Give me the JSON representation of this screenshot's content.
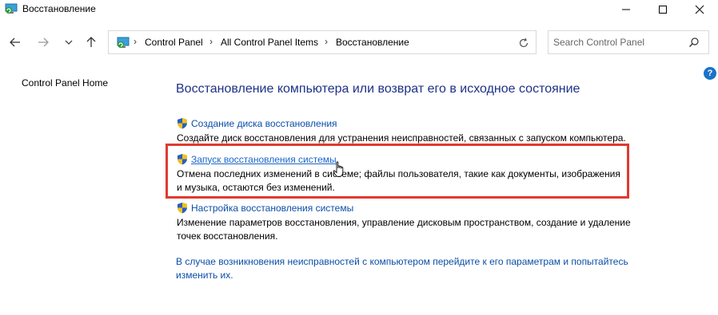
{
  "window": {
    "title": "Восстановление"
  },
  "title_controls": {
    "minimize_icon": "minimize-icon",
    "maximize_icon": "maximize-icon",
    "close_icon": "close-icon"
  },
  "nav": {
    "back_icon": "back-arrow-icon",
    "forward_icon": "forward-arrow-icon",
    "recent_icon": "chevron-down-icon",
    "up_icon": "up-arrow-icon"
  },
  "address": {
    "breadcrumbs": [
      "Control Panel",
      "All Control Panel Items",
      "Восстановление"
    ],
    "separator": "›"
  },
  "search": {
    "placeholder": "Search Control Panel"
  },
  "sidebar": {
    "home_link": "Control Panel Home"
  },
  "help": {
    "label": "?"
  },
  "main": {
    "title": "Восстановление компьютера или возврат его в исходное состояние",
    "tasks": [
      {
        "link": "Создание диска восстановления",
        "description": "Создайте диск восстановления для устранения неисправностей, связанных с запуском компьютера."
      },
      {
        "link": "Запуск восстановления системы",
        "description": "Отмена последних изменений в системе; файлы пользователя, такие как документы, изображения и музыка, остаются без изменений."
      },
      {
        "link": "Настройка восстановления системы",
        "description": "Изменение параметров восстановления, управление дисковым пространством, создание и удаление точек восстановления."
      }
    ],
    "bottom_link": "В случае возникновения неисправностей с компьютером перейдите к его параметрам и попытайтесь изменить их."
  },
  "colors": {
    "link": "#0a4ea8",
    "title": "#1e3287",
    "highlight": "#e03a2f"
  }
}
